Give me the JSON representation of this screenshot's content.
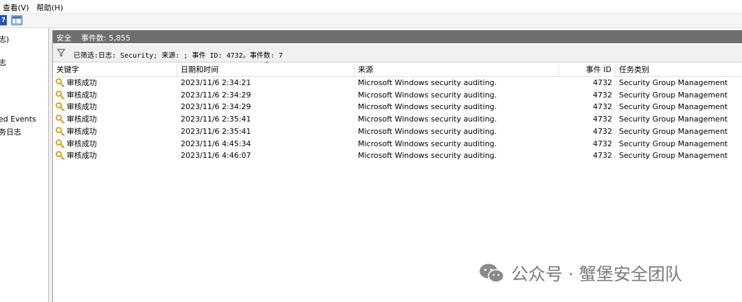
{
  "menu": {
    "view": "查看(V)",
    "help": "帮助(H)"
  },
  "toolbar": {
    "help_glyph": "?"
  },
  "tree": {
    "items": [
      "志)",
      "志",
      "ed Events",
      "务日志"
    ]
  },
  "panel": {
    "title": "安全",
    "event_count_label": "事件数: 5,855"
  },
  "filter": {
    "text": "已筛选:日志: Security; 来源: ; 事件 ID: 4732。事件数: 7"
  },
  "columns": {
    "keyword": "关键字",
    "datetime": "日期和时间",
    "source": "来源",
    "event_id": "事件 ID",
    "task_category": "任务类别"
  },
  "rows": [
    {
      "keyword": "审核成功",
      "datetime": "2023/11/6 2:34:21",
      "source": "Microsoft Windows security auditing.",
      "event_id": "4732",
      "task": "Security Group Management"
    },
    {
      "keyword": "审核成功",
      "datetime": "2023/11/6 2:34:29",
      "source": "Microsoft Windows security auditing.",
      "event_id": "4732",
      "task": "Security Group Management"
    },
    {
      "keyword": "审核成功",
      "datetime": "2023/11/6 2:34:29",
      "source": "Microsoft Windows security auditing.",
      "event_id": "4732",
      "task": "Security Group Management"
    },
    {
      "keyword": "审核成功",
      "datetime": "2023/11/6 2:35:41",
      "source": "Microsoft Windows security auditing.",
      "event_id": "4732",
      "task": "Security Group Management"
    },
    {
      "keyword": "审核成功",
      "datetime": "2023/11/6 2:35:41",
      "source": "Microsoft Windows security auditing.",
      "event_id": "4732",
      "task": "Security Group Management"
    },
    {
      "keyword": "审核成功",
      "datetime": "2023/11/6 4:45:34",
      "source": "Microsoft Windows security auditing.",
      "event_id": "4732",
      "task": "Security Group Management"
    },
    {
      "keyword": "审核成功",
      "datetime": "2023/11/6 4:46:07",
      "source": "Microsoft Windows security auditing.",
      "event_id": "4732",
      "task": "Security Group Management"
    }
  ],
  "watermark": {
    "text": "公众号 · 蟹堡安全团队",
    "icon": "wechat-logo-icon"
  },
  "colors": {
    "panel_header_bg": "#6f6f6f",
    "key_icon": "#d9a21b"
  }
}
